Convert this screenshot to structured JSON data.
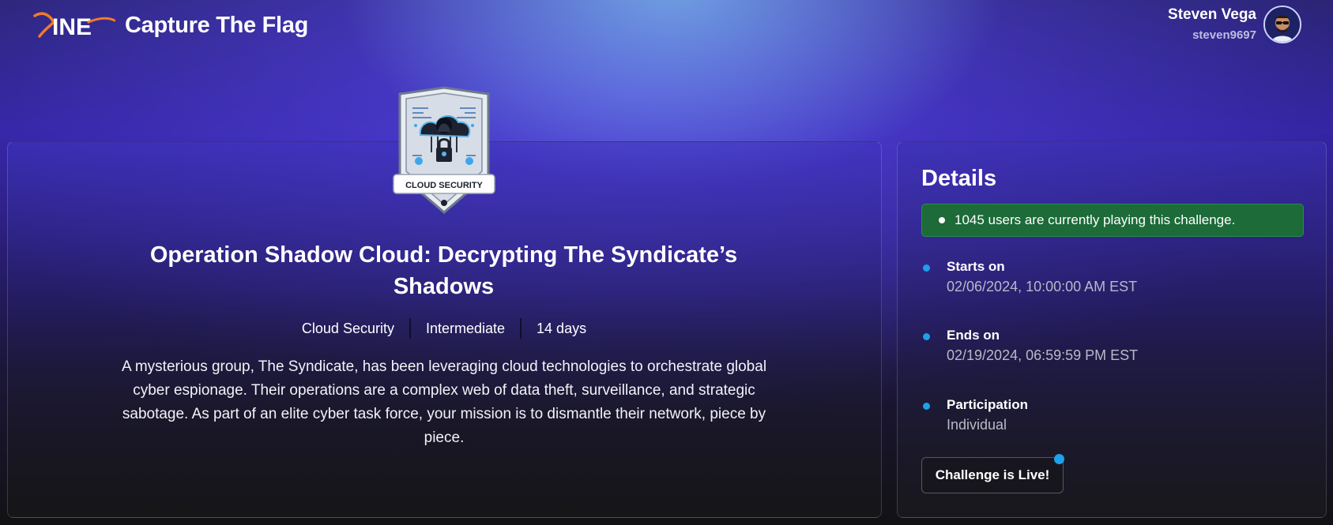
{
  "header": {
    "logo_text": "INE",
    "app_title": "Capture The Flag",
    "user_name": "Steven Vega",
    "user_handle": "steven9697"
  },
  "challenge": {
    "badge_label": "CLOUD SECURITY",
    "title": "Operation Shadow Cloud: Decrypting The Syndicate’s Shadows",
    "category": "Cloud Security",
    "level": "Intermediate",
    "duration": "14 days",
    "description": "A mysterious group, The Syndicate, has been leveraging cloud technologies to orchestrate global cyber espionage. Their operations are a complex web of data theft, surveillance, and strategic sabotage. As part of an elite cyber task force, your mission is to dismantle their network, piece by piece."
  },
  "details": {
    "title": "Details",
    "live_banner": "1045 users are currently playing this challenge.",
    "starts_label": "Starts on",
    "starts_value": "02/06/2024, 10:00:00 AM EST",
    "ends_label": "Ends on",
    "ends_value": "02/19/2024, 06:59:59 PM EST",
    "participation_label": "Participation",
    "participation_value": "Individual",
    "status_button": "Challenge is Live!"
  },
  "colors": {
    "accent_blue": "#1ea0ea",
    "live_green": "#1c6b38",
    "logo_orange": "#f07a2a"
  },
  "icons": [
    "ine-logo",
    "user-avatar",
    "cloud-security-badge",
    "live-dot",
    "bullet-dot"
  ]
}
